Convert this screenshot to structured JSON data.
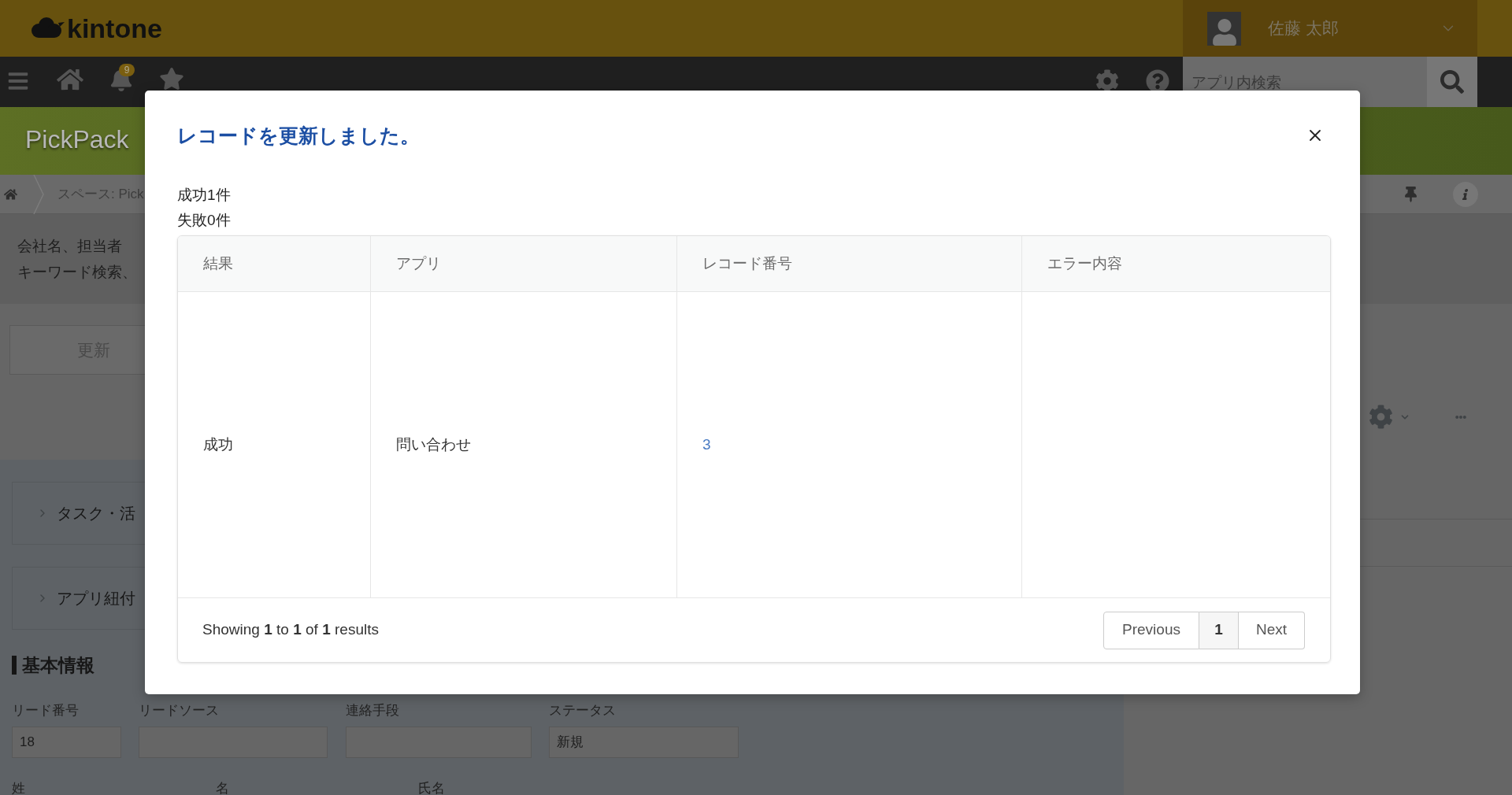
{
  "header": {
    "logo": "kintone",
    "user_name": "佐藤 太郎"
  },
  "nav": {
    "notification_badge": "9",
    "search": {
      "placeholder": "アプリ内検索"
    }
  },
  "app_header": {
    "title": "PickPack"
  },
  "breadcrumb": {
    "items": [
      "スペース: Pick"
    ]
  },
  "description": {
    "lines": [
      "会社名、担当者",
      "キーワード検索、"
    ]
  },
  "toolbar": {
    "button": "更新"
  },
  "sections": [
    {
      "label": "タスク・活",
      "expanded": false
    },
    {
      "label": "アプリ紐付",
      "expanded": false
    }
  ],
  "form": {
    "heading": "基本情報",
    "fields": [
      {
        "label": "リード番号",
        "value": "18"
      },
      {
        "label": "リードソース"
      },
      {
        "label": "連絡手段"
      },
      {
        "label": "ステータス",
        "value": "新規"
      }
    ],
    "next_row_labels": [
      "姓",
      "名",
      "氏名"
    ]
  },
  "dialog": {
    "title": "レコードを更新しました。",
    "summary": [
      "成功1件",
      "失敗0件"
    ],
    "table": {
      "columns": [
        "結果",
        "アプリ",
        "レコード番号",
        "エラー内容"
      ],
      "rows": [
        {
          "result": "成功",
          "app": "問い合わせ",
          "record_number": "3"
        }
      ],
      "footer": {
        "info": "Showing **1** to **1** of **1** results",
        "previous": "Previous",
        "pages": [
          {
            "label": "1",
            "selected": true
          }
        ],
        "next": "Next"
      }
    }
  }
}
